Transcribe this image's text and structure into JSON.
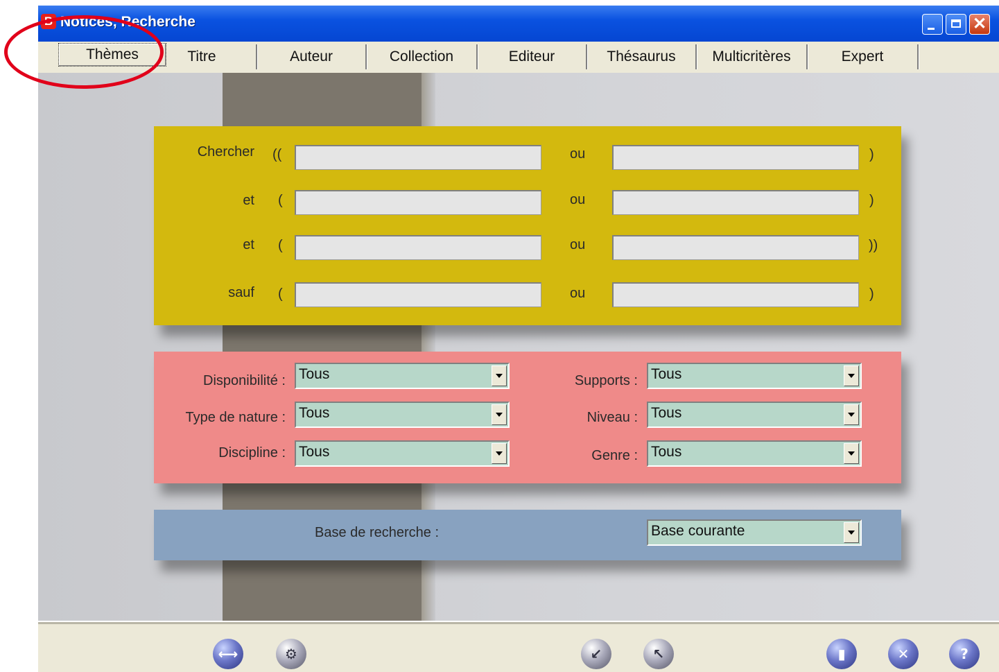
{
  "window": {
    "title": "Notices, Recherche",
    "app_icon_letter": "B"
  },
  "tabs": [
    {
      "label": "Thèmes",
      "active": true
    },
    {
      "label": "Titre"
    },
    {
      "label": "Auteur"
    },
    {
      "label": "Collection"
    },
    {
      "label": "Editeur"
    },
    {
      "label": "Thésaurus"
    },
    {
      "label": "Multicritères"
    },
    {
      "label": "Expert"
    }
  ],
  "search": {
    "rows": [
      {
        "label": "Chercher",
        "open": "((",
        "sep": "ou",
        "close": ")"
      },
      {
        "label": "et",
        "open": "(",
        "sep": "ou",
        "close": ")"
      },
      {
        "label": "et",
        "open": "(",
        "sep": "ou",
        "close": "))"
      },
      {
        "label": "sauf",
        "open": "(",
        "sep": "ou",
        "close": ")"
      }
    ]
  },
  "filters": {
    "disponibilite": {
      "label": "Disponibilité :",
      "value": "Tous"
    },
    "type_nature": {
      "label": "Type de nature :",
      "value": "Tous"
    },
    "discipline": {
      "label": "Discipline :",
      "value": "Tous"
    },
    "supports": {
      "label": "Supports :",
      "value": "Tous"
    },
    "niveau": {
      "label": "Niveau :",
      "value": "Tous"
    },
    "genre": {
      "label": "Genre :",
      "value": "Tous"
    }
  },
  "base": {
    "label": "Base de recherche :",
    "value": "Base courante"
  },
  "colors": {
    "yellow_panel": "#d3b90e",
    "pink_panel": "#ef8a89",
    "blue_panel": "#88a2c0",
    "combo_bg": "#b7d7c9",
    "annotation": "#e1001a"
  },
  "toolbar_icons": [
    "link-icon",
    "settings-gear-icon",
    "import-icon",
    "export-icon",
    "eraser-icon",
    "close-icon",
    "help-icon"
  ]
}
